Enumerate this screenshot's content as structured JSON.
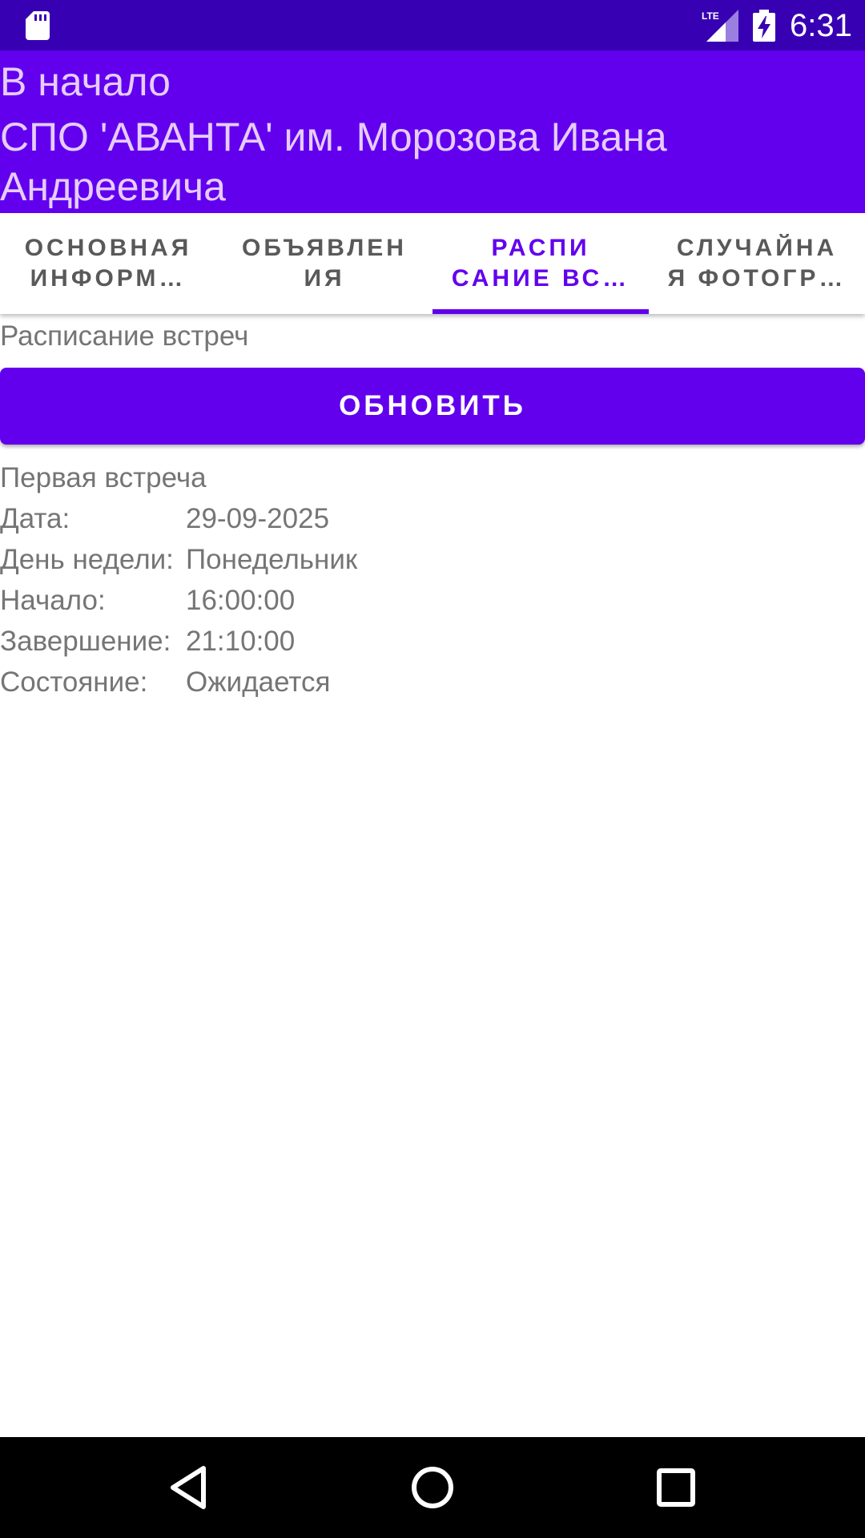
{
  "status_bar": {
    "time": "6:31",
    "network": "LTE",
    "icons": [
      "sd-card-icon",
      "lte-signal-icon",
      "battery-charging-icon"
    ]
  },
  "app_bar": {
    "home_link": "В начало",
    "title": "СПО 'АВАНТА' им. Морозова Ивана Андреевича"
  },
  "tabs": [
    {
      "label": "ОСНОВНАЯ\nИНФОРМ…",
      "active": false
    },
    {
      "label": "ОБЪЯВЛЕН\nИЯ",
      "active": false
    },
    {
      "label": "РАСПИ\nСАНИЕ ВС…",
      "active": true
    },
    {
      "label": "СЛУЧАЙНА\nЯ ФОТОГР…",
      "active": false
    }
  ],
  "schedule": {
    "section_title": "Расписание встреч",
    "refresh_label": "ОБНОВИТЬ",
    "meeting_title": "Первая встреча",
    "rows": [
      {
        "label": "Дата:",
        "value": "29-09-2025"
      },
      {
        "label": "День недели:",
        "value": "Понедельник"
      },
      {
        "label": "Начало:",
        "value": "16:00:00"
      },
      {
        "label": "Завершение:",
        "value": "21:10:00"
      },
      {
        "label": "Состояние:",
        "value": "Ожидается"
      }
    ]
  },
  "nav_bar": {
    "icons": [
      "back-icon",
      "home-icon",
      "recents-icon"
    ]
  },
  "colors": {
    "primary": "#6200ee",
    "primary_dark": "#3700b3",
    "app_bar_text": "#e6ccff",
    "tab_text": "#595959",
    "body_text": "#757575"
  }
}
